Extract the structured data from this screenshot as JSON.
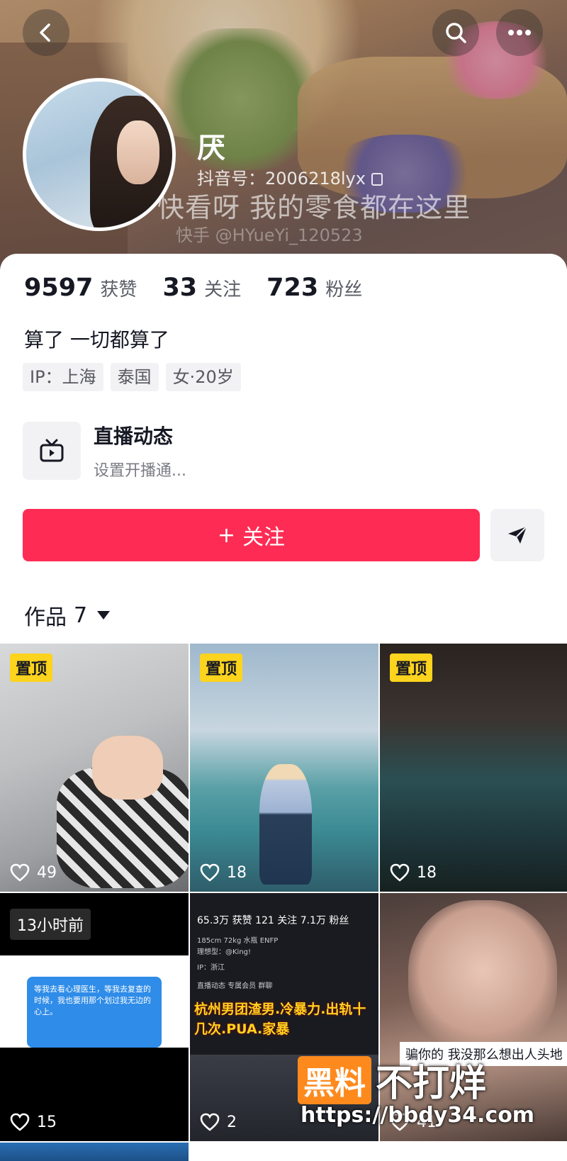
{
  "header": {
    "cover_caption": "快看呀 我的零食都在这里",
    "cover_watermark": "快手 @HYueYi_120523",
    "name": "厌",
    "douyin_id": "抖音号：2006218lyx"
  },
  "stats": {
    "likes_count": "9597",
    "likes_label": "获赞",
    "following_count": "33",
    "following_label": "关注",
    "followers_count": "723",
    "followers_label": "粉丝"
  },
  "bio": "算了 一切都算了",
  "tags": [
    "IP：上海",
    "泰国",
    "女·20岁"
  ],
  "live": {
    "title": "直播动态",
    "subtitle": "设置开播通..."
  },
  "follow_button": {
    "icon": "+",
    "label": "关注"
  },
  "works": {
    "label": "作品",
    "count": "7"
  },
  "grid": [
    {
      "badge": "置顶",
      "likes": "49"
    },
    {
      "badge": "置顶",
      "likes": "18"
    },
    {
      "badge": "置顶",
      "likes": "18"
    },
    {
      "badge": "13小时前",
      "likes": "15"
    },
    {
      "likes": "2"
    },
    {
      "likes": "41"
    }
  ],
  "tile5": {
    "stats_line": "65.3万 获赞  121 关注  7.1万 粉丝",
    "info_line": "185cm 72kg 水瓶 ENFP",
    "ideal_line": "理想型：@King!",
    "ip_line": "IP：浙江",
    "menu_line": "直播动态   专属会员   群聊",
    "headline": "杭州男团渣男.冷暴力.出轨十几次.PUA.家暴"
  },
  "tile4_chat": "等我去看心理医生，等我去复查的时候，我也要用那个划过我无边的心上。",
  "tile6_caption": "骗你的 我没那么想出人头地",
  "site_watermark": {
    "box": "黑料",
    "text": "不打烊",
    "url": "https://bbdy34.com"
  },
  "colors": {
    "accent": "#fe2c55",
    "pin_badge": "#fcd31d",
    "tag_bg": "#f2f2f4"
  },
  "icons": [
    "back-icon",
    "search-icon",
    "more-icon",
    "copy-icon",
    "tv-icon",
    "send-icon",
    "heart-icon",
    "caret-down-icon"
  ]
}
